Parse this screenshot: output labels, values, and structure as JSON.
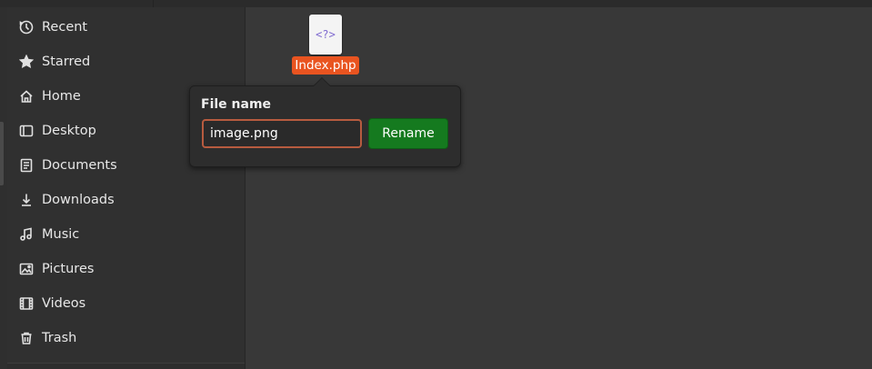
{
  "sidebar": {
    "items": [
      {
        "label": "Recent",
        "icon": "clock-icon"
      },
      {
        "label": "Starred",
        "icon": "star-icon"
      },
      {
        "label": "Home",
        "icon": "home-icon"
      },
      {
        "label": "Desktop",
        "icon": "desktop-icon"
      },
      {
        "label": "Documents",
        "icon": "documents-icon"
      },
      {
        "label": "Downloads",
        "icon": "download-icon"
      },
      {
        "label": "Music",
        "icon": "music-icon"
      },
      {
        "label": "Pictures",
        "icon": "pictures-icon"
      },
      {
        "label": "Videos",
        "icon": "videos-icon"
      },
      {
        "label": "Trash",
        "icon": "trash-icon"
      }
    ]
  },
  "file": {
    "name": "Index.php",
    "icon_glyph": "<?>",
    "icon": "php-file-icon"
  },
  "rename_popover": {
    "title": "File name",
    "input_value": "image.png",
    "button_label": "Rename"
  },
  "colors": {
    "accent": "#e95420",
    "rename_button": "#157a1f",
    "input_border": "#b75b3f",
    "sidebar_bg": "#303030",
    "main_bg": "#383838"
  }
}
